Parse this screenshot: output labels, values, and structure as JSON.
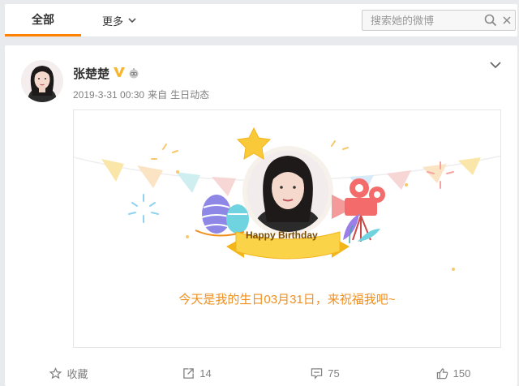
{
  "tabs": {
    "all_label": "全部",
    "more_label": "更多"
  },
  "search": {
    "placeholder": "搜索她的微博",
    "value": ""
  },
  "post": {
    "author": "张楚楚",
    "date": "2019-3-31 00:30",
    "via_prefix": "来自",
    "source": "生日动态",
    "ribbon_text": "Happy Birthday",
    "message": "今天是我的生日03月31日，来祝福我吧~"
  },
  "actions": {
    "favorite_label": "收藏",
    "repost_count": "14",
    "comment_count": "75",
    "like_count": "150"
  },
  "colors": {
    "accent": "#ff8200",
    "message": "#f08f1e",
    "vip": "#f6b72e"
  }
}
